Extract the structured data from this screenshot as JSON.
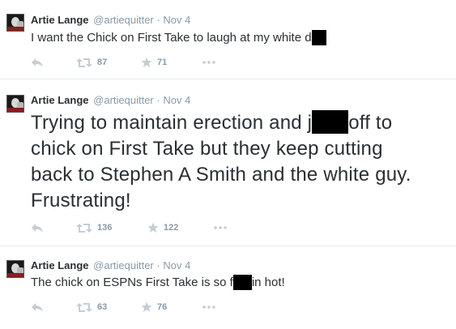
{
  "tweets": [
    {
      "name": "Artie Lange",
      "handle": "@artiequitter",
      "date": "Nov 4",
      "text_before": "I want the Chick on First Take to laugh at my white d",
      "text_after": "",
      "retweets": "87",
      "favorites": "71"
    },
    {
      "name": "Artie Lange",
      "handle": "@artiequitter",
      "date": "Nov 4",
      "line1_before": "Trying to maintain erection and j",
      "line1_after": "off to",
      "line2": "chick on First Take but they keep cutting",
      "line3": "back to Stephen A Smith and the white guy.",
      "line4": "Frustrating!",
      "retweets": "136",
      "favorites": "122"
    },
    {
      "name": "Artie Lange",
      "handle": "@artiequitter",
      "date": "Nov 4",
      "text_before": "The chick on ESPNs First Take is so f",
      "text_after": "in hot!",
      "retweets": "63",
      "favorites": "76"
    }
  ],
  "separator": "·",
  "icons": {
    "reply": "reply-icon",
    "retweet": "retweet-icon",
    "favorite": "star-icon",
    "more": "more-icon"
  }
}
